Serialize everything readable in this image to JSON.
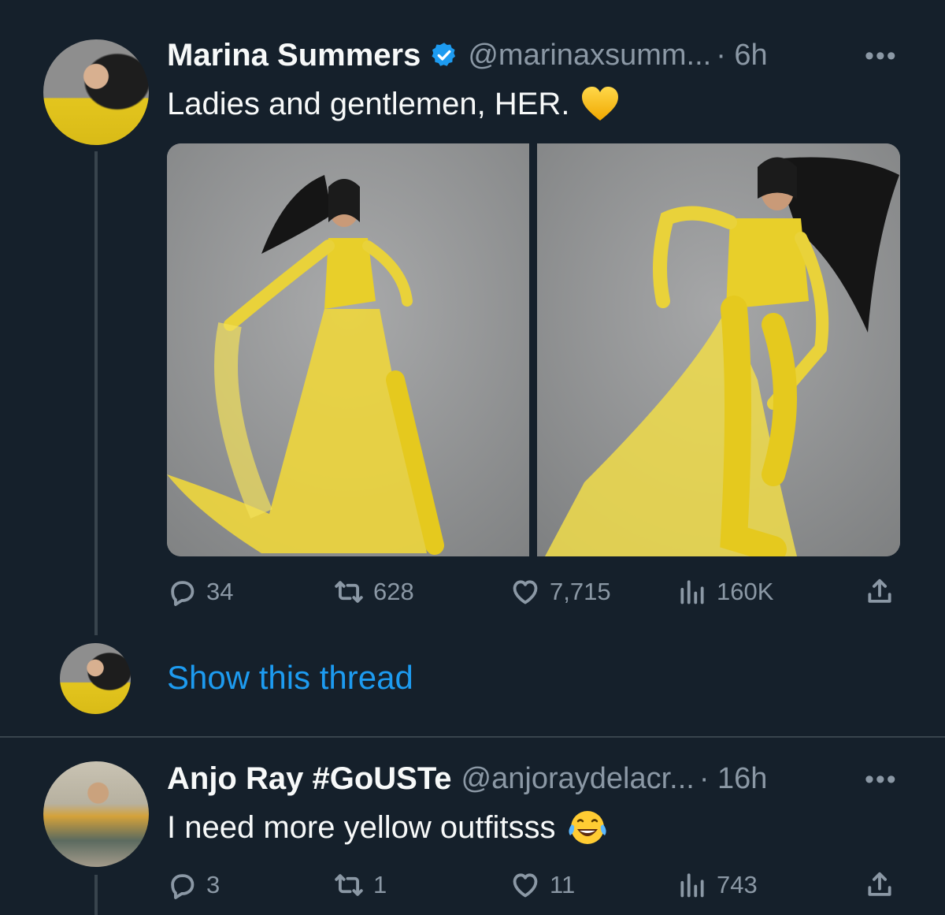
{
  "tweet1": {
    "name": "Marina Summers",
    "handle": "@marinaxsumm...",
    "time": "· 6h",
    "more": "•••",
    "text": "Ladies and gentlemen, HER.",
    "emoji": "yellow-heart",
    "metrics": {
      "replies": "34",
      "retweets": "628",
      "likes": "7,715",
      "views": "160K"
    }
  },
  "thread": {
    "show_label": "Show this thread"
  },
  "tweet2": {
    "name": "Anjo Ray #GoUSTe",
    "handle": "@anjoraydelacr...",
    "time": "· 16h",
    "more": "•••",
    "text": "I need more yellow outfitsss",
    "emoji": "laughing-tears",
    "metrics": {
      "replies": "3",
      "retweets": "1",
      "likes": "11",
      "views": "743"
    }
  },
  "colors": {
    "background": "#15202b",
    "secondary_text": "#8b98a5",
    "accent": "#1d9bf0",
    "divider": "#38444d"
  }
}
